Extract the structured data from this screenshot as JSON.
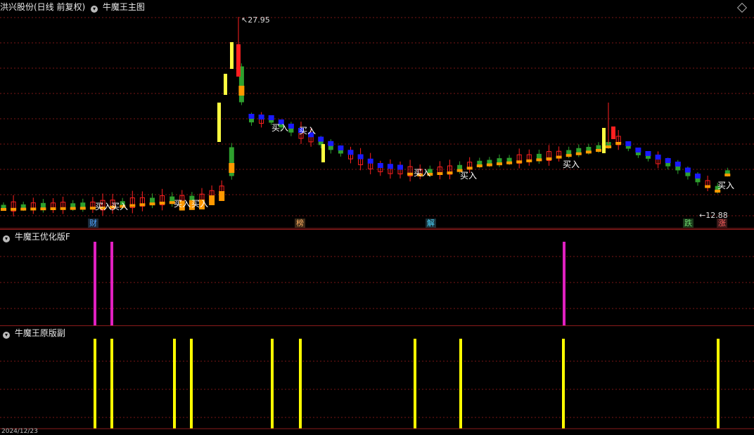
{
  "main_pane": {
    "stock_name": "洪兴股份(日线 前复权)",
    "indicator_name": "牛魔王主图",
    "high_label": "27.95",
    "low_label": "12.88",
    "buy_label": "买入",
    "tags": [
      {
        "text": "财",
        "color": "#4da3ff",
        "bg": "#1a2a3a"
      },
      {
        "text": "榜",
        "color": "#ffb060",
        "bg": "#3a2a18"
      },
      {
        "text": "解",
        "color": "#4dd6ff",
        "bg": "#183038"
      },
      {
        "text": "跌",
        "color": "#6ed86e",
        "bg": "#1a3a1a"
      },
      {
        "text": "涨",
        "color": "#ff6060",
        "bg": "#3a1818"
      }
    ]
  },
  "sub_pane_1": {
    "title": "牛魔王优化版F",
    "bar_color": "#e020c0",
    "signal_count": 3
  },
  "sub_pane_2": {
    "title": "牛魔王原版副",
    "bar_color": "#ffff00",
    "signal_count": 12
  },
  "footer": {
    "date_label": "2024/12/23"
  },
  "colors": {
    "up": "#ff2020",
    "down": "#2ea02e",
    "trend_up": "#ff9900",
    "trend_down": "#1a1aff",
    "grid": "#8a1b1b"
  }
}
